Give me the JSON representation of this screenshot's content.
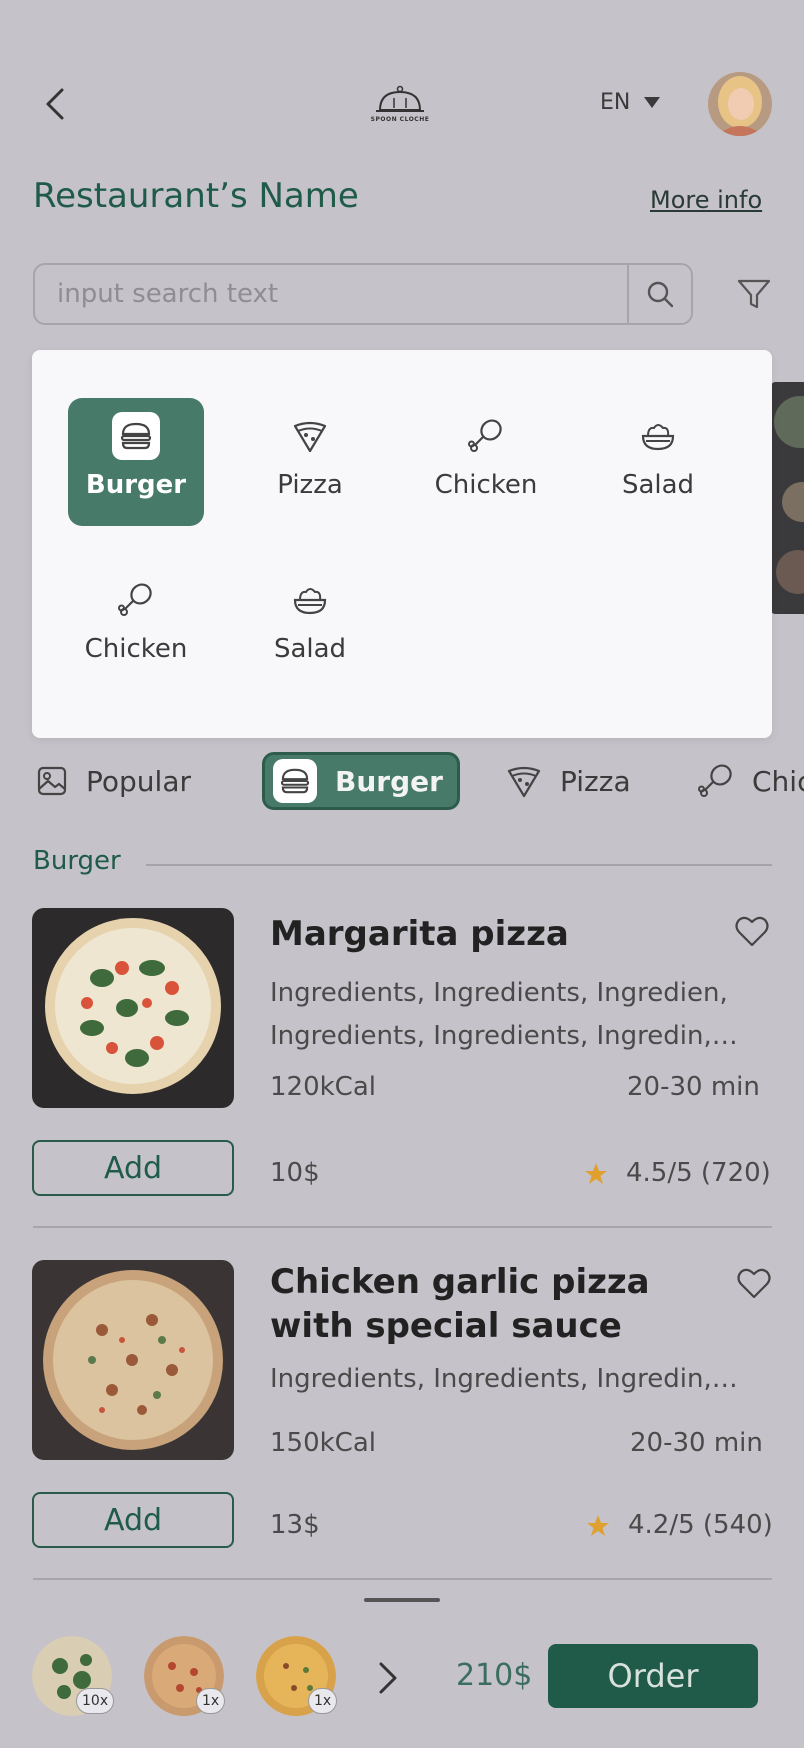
{
  "header": {
    "logo_text": "SPOON CLOCHE",
    "language": "EN",
    "restaurant_name": "Restaurant’s Name",
    "more_info": "More info"
  },
  "search": {
    "placeholder": "input search text",
    "value": ""
  },
  "dropdown": {
    "items": [
      {
        "label": "Burger",
        "icon": "burger-icon",
        "active": true
      },
      {
        "label": "Pizza",
        "icon": "pizza-icon",
        "active": false
      },
      {
        "label": "Chicken",
        "icon": "drumstick-icon",
        "active": false
      },
      {
        "label": "Salad",
        "icon": "salad-bowl-icon",
        "active": false
      },
      {
        "label": "Chicken",
        "icon": "drumstick-icon",
        "active": false
      },
      {
        "label": "Salad",
        "icon": "salad-bowl-icon",
        "active": false
      }
    ]
  },
  "category_bar": {
    "items": [
      {
        "label": "Popular",
        "icon": "image-icon"
      },
      {
        "label": "Burger",
        "icon": "burger-icon",
        "active": true
      },
      {
        "label": "Pizza",
        "icon": "pizza-icon"
      },
      {
        "label": "Chic",
        "icon": "drumstick-icon"
      }
    ]
  },
  "section_title": "Burger",
  "menu_items": [
    {
      "title": "Margarita pizza",
      "ingredients_line1": "Ingredients, Ingredients, Ingredien,",
      "ingredients_line2": "Ingredients, Ingredients, Ingredin,…",
      "kcal": "120kCal",
      "time": "20-30 min",
      "price": "10$",
      "rating": "4.5/5 (720)",
      "add_label": "Add"
    },
    {
      "title_line1": "Chicken garlic pizza",
      "title_line2": "with special sauce",
      "ingredients_line1": "Ingredients, Ingredients, Ingredin,…",
      "kcal": "150kCal",
      "time": "20-30 min",
      "price": "13$",
      "rating": "4.2/5 (540)",
      "add_label": "Add"
    }
  ],
  "cart": {
    "quantities": [
      "10x",
      "1x",
      "1x"
    ],
    "total": "210$",
    "order_label": "Order"
  },
  "colors": {
    "brand_green": "#1f5b48",
    "active_chip": "#477a68",
    "star": "#e0a030",
    "overlay_bg": "#c5c3c9"
  }
}
